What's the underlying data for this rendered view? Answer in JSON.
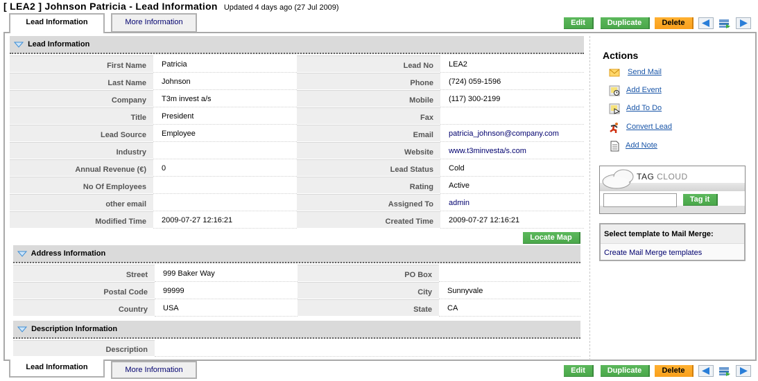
{
  "header": {
    "title": "[ LEA2 ] Johnson Patricia - Lead Information",
    "updated": "Updated 4 days ago (27 Jul 2009)"
  },
  "tabs": [
    {
      "label": "Lead Information",
      "active": true
    },
    {
      "label": "More Information",
      "active": false
    }
  ],
  "toolbar": {
    "edit_label": "Edit",
    "duplicate_label": "Duplicate",
    "delete_label": "Delete",
    "prev_icon": "left-arrow-icon",
    "print_icon": "print-icon",
    "next_icon": "right-arrow-icon",
    "colors": {
      "green": "#4caf50",
      "orange": "#f9a01c"
    }
  },
  "sections": {
    "lead": {
      "title": "Lead Information",
      "left": [
        {
          "label": "First Name",
          "value": "Patricia"
        },
        {
          "label": "Last Name",
          "value": "Johnson"
        },
        {
          "label": "Company",
          "value": "T3m invest a/s"
        },
        {
          "label": "Title",
          "value": "President"
        },
        {
          "label": "Lead Source",
          "value": "Employee"
        },
        {
          "label": "Industry",
          "value": ""
        },
        {
          "label": "Annual Revenue (€)",
          "value": "0"
        },
        {
          "label": "No Of Employees",
          "value": ""
        },
        {
          "label": "other email",
          "value": ""
        },
        {
          "label": "Modified Time",
          "value": "2009-07-27 12:16:21"
        }
      ],
      "right": [
        {
          "label": "Lead No",
          "value": "LEA2"
        },
        {
          "label": "Phone",
          "value": "(724) 059-1596"
        },
        {
          "label": "Mobile",
          "value": "(117) 300-2199"
        },
        {
          "label": "Fax",
          "value": ""
        },
        {
          "label": "Email",
          "value": "patricia_johnson@company.com"
        },
        {
          "label": "Website",
          "value": "www.t3minvesta/s.com"
        },
        {
          "label": "Lead Status",
          "value": "Cold"
        },
        {
          "label": "Rating",
          "value": "Active"
        },
        {
          "label": "Assigned To",
          "value": "admin"
        },
        {
          "label": "Created Time",
          "value": "2009-07-27 12:16:21"
        }
      ]
    },
    "address": {
      "title": "Address Information",
      "locate_map_label": "Locate Map",
      "left": [
        {
          "label": "Street",
          "value": "999 Baker Way"
        },
        {
          "label": "Postal Code",
          "value": "99999"
        },
        {
          "label": "Country",
          "value": "USA"
        }
      ],
      "right": [
        {
          "label": "PO Box",
          "value": ""
        },
        {
          "label": "City",
          "value": "Sunnyvale"
        },
        {
          "label": "State",
          "value": "CA"
        }
      ]
    },
    "description": {
      "title": "Description Information",
      "label": "Description",
      "value": ""
    }
  },
  "sidebar": {
    "actions_title": "Actions",
    "actions": [
      {
        "label": "Send Mail",
        "icon": "mail-icon"
      },
      {
        "label": "Add Event",
        "icon": "calendar-event-icon"
      },
      {
        "label": "Add To Do",
        "icon": "calendar-todo-icon"
      },
      {
        "label": "Convert Lead",
        "icon": "convert-lead-icon"
      },
      {
        "label": "Add Note",
        "icon": "note-icon"
      }
    ],
    "tag_cloud": {
      "title_1": "TAG",
      "title_2": "CLOUD",
      "input_value": "",
      "button_label": "Tag it"
    },
    "mail_merge": {
      "header": "Select template to Mail Merge:",
      "link": "Create Mail Merge templates"
    }
  }
}
